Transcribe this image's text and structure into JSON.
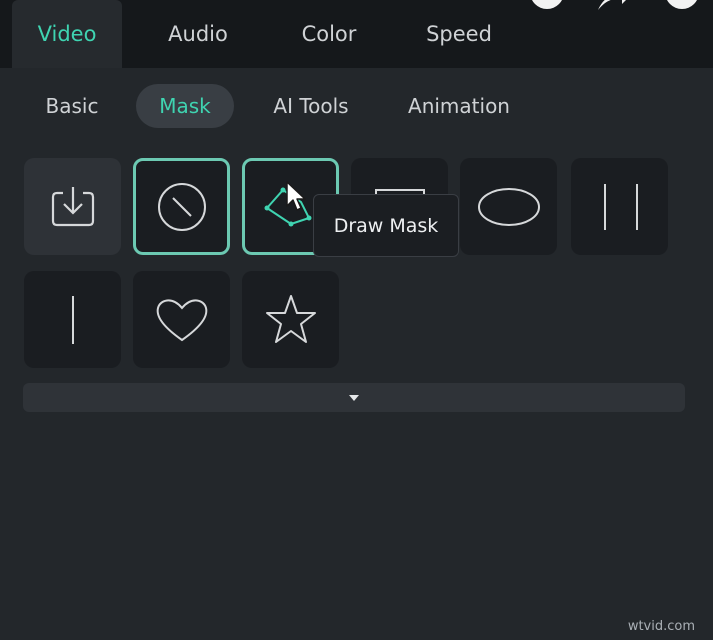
{
  "tabs": [
    {
      "label": "Video",
      "active": true
    },
    {
      "label": "Audio",
      "active": false
    },
    {
      "label": "Color",
      "active": false
    },
    {
      "label": "Speed",
      "active": false
    }
  ],
  "subtabs": [
    {
      "label": "Basic",
      "active": false
    },
    {
      "label": "Mask",
      "active": true
    },
    {
      "label": "AI Tools",
      "active": false
    },
    {
      "label": "Animation",
      "active": false
    }
  ],
  "mask_tiles": [
    {
      "icon": "import-icon"
    },
    {
      "icon": "no-mask-icon",
      "selected": true
    },
    {
      "icon": "draw-mask-icon",
      "selected": true
    },
    {
      "icon": "rectangle-mask-icon"
    },
    {
      "icon": "ellipse-mask-icon"
    },
    {
      "icon": "double-line-mask-icon"
    },
    {
      "icon": "single-line-mask-icon"
    },
    {
      "icon": "heart-mask-icon"
    },
    {
      "icon": "star-mask-icon"
    }
  ],
  "tooltip": {
    "text": "Draw Mask"
  },
  "watermark": {
    "text": "wtvid.com"
  },
  "colors": {
    "accent": "#3fd4b1",
    "background": "#23272b",
    "selection_border": "#6cc9b2"
  }
}
